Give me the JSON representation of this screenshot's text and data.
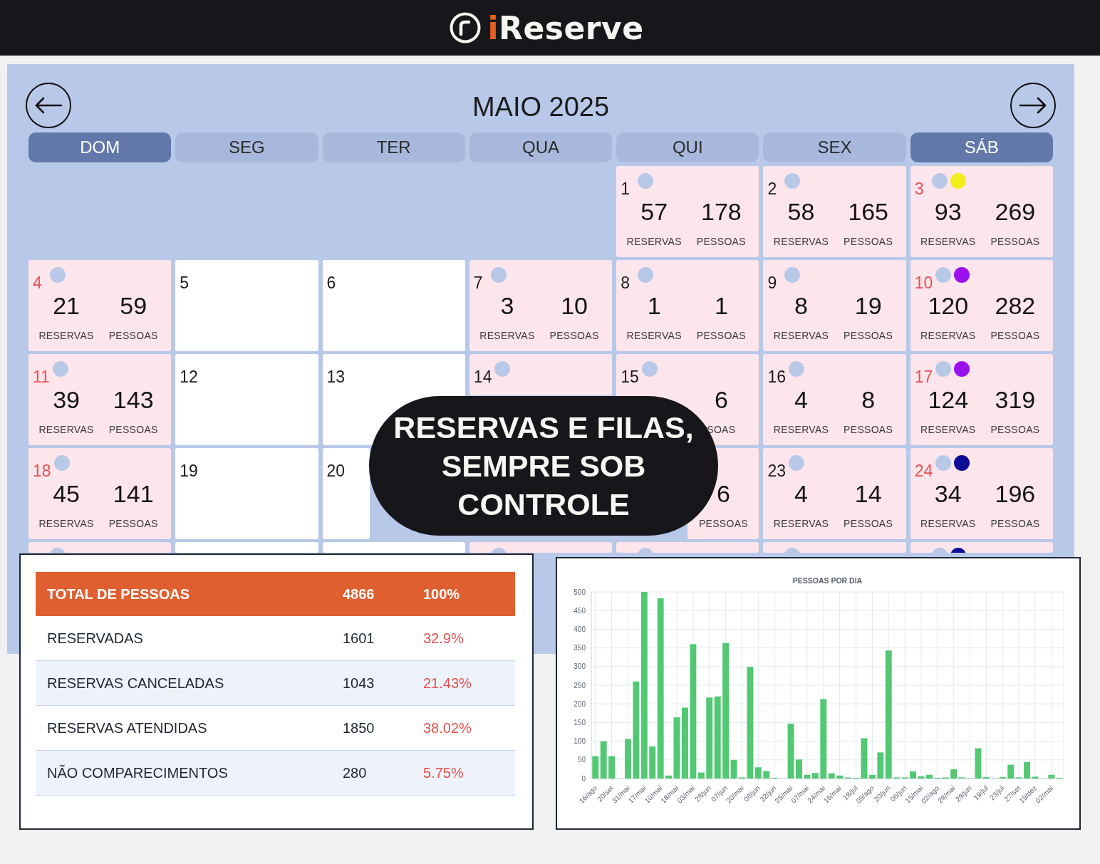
{
  "logo": {
    "text": "iReserve"
  },
  "calendar": {
    "month_title": "MAIO 2025",
    "weekdays": [
      {
        "label": "DOM",
        "selected": true
      },
      {
        "label": "SEG",
        "selected": false
      },
      {
        "label": "TER",
        "selected": false
      },
      {
        "label": "QUA",
        "selected": false
      },
      {
        "label": "QUI",
        "selected": false
      },
      {
        "label": "SEX",
        "selected": false
      },
      {
        "label": "SÁB",
        "selected": true
      }
    ],
    "weeks": [
      {
        "days": [
          {
            "kind": "blank"
          },
          {
            "kind": "blank"
          },
          {
            "kind": "blank"
          },
          {
            "kind": "blank"
          },
          {
            "kind": "open",
            "day": "1",
            "markers": [
              {
                "color": "#b8c9e8"
              }
            ],
            "reservations": {
              "value": "57",
              "label": "RESERVAS"
            },
            "people": {
              "value": "178",
              "label": "PESSOAS"
            }
          },
          {
            "kind": "open",
            "day": "2",
            "markers": [
              {
                "color": "#b8c9e8"
              }
            ],
            "reservations": {
              "value": "58",
              "label": "RESERVAS"
            },
            "people": {
              "value": "165",
              "label": "PESSOAS"
            }
          },
          {
            "kind": "open",
            "day": "3",
            "markers": [
              {
                "color": "#b8c9e8"
              },
              {
                "color": "#f2ee1c"
              }
            ],
            "reservations": {
              "value": "93",
              "label": "RESERVAS"
            },
            "people": {
              "value": "269",
              "label": "PESSOAS"
            }
          }
        ]
      },
      {
        "days": [
          {
            "kind": "open",
            "day": "4",
            "markers": [
              {
                "color": "#b8c9e8"
              }
            ],
            "reservations": {
              "value": "21",
              "label": "RESERVAS"
            },
            "people": {
              "value": "59",
              "label": "PESSOAS"
            }
          },
          {
            "kind": "closed",
            "day": "5"
          },
          {
            "kind": "closed",
            "day": "6"
          },
          {
            "kind": "open",
            "day": "7",
            "markers": [
              {
                "color": "#b8c9e8"
              }
            ],
            "reservations": {
              "value": "3",
              "label": "RESERVAS"
            },
            "people": {
              "value": "10",
              "label": "PESSOAS"
            }
          },
          {
            "kind": "open",
            "day": "8",
            "markers": [
              {
                "color": "#b8c9e8"
              }
            ],
            "reservations": {
              "value": "1",
              "label": "RESERVAS"
            },
            "people": {
              "value": "1",
              "label": "PESSOAS"
            }
          },
          {
            "kind": "open",
            "day": "9",
            "markers": [
              {
                "color": "#b8c9e8"
              }
            ],
            "reservations": {
              "value": "8",
              "label": "RESERVAS"
            },
            "people": {
              "value": "19",
              "label": "PESSOAS"
            }
          },
          {
            "kind": "open",
            "day": "10",
            "markers": [
              {
                "color": "#b8c9e8"
              },
              {
                "color": "#9a10ee"
              }
            ],
            "reservations": {
              "value": "120",
              "label": "RESERVAS"
            },
            "people": {
              "value": "282",
              "label": "PESSOAS"
            }
          }
        ]
      },
      {
        "days": [
          {
            "kind": "open",
            "day": "11",
            "markers": [
              {
                "color": "#b8c9e8"
              }
            ],
            "reservations": {
              "value": "39",
              "label": "RESERVAS"
            },
            "people": {
              "value": "143",
              "label": "PESSOAS"
            }
          },
          {
            "kind": "closed",
            "day": "12"
          },
          {
            "kind": "closed",
            "day": "13"
          },
          {
            "kind": "open",
            "day": "14",
            "markers": [
              {
                "color": "#b8c9e8"
              }
            ]
          },
          {
            "kind": "open",
            "day": "15",
            "markers": [
              {
                "color": "#b8c9e8"
              }
            ],
            "people": {
              "value": "6",
              "label": "SOAS"
            }
          },
          {
            "kind": "open",
            "day": "16",
            "markers": [
              {
                "color": "#b8c9e8"
              }
            ],
            "reservations": {
              "value": "4",
              "label": "RESERVAS"
            },
            "people": {
              "value": "8",
              "label": "PESSOAS"
            }
          },
          {
            "kind": "open",
            "day": "17",
            "markers": [
              {
                "color": "#b8c9e8"
              },
              {
                "color": "#9a10ee"
              }
            ],
            "reservations": {
              "value": "124",
              "label": "RESERVAS"
            },
            "people": {
              "value": "319",
              "label": "PESSOAS"
            }
          }
        ]
      },
      {
        "days": [
          {
            "kind": "open",
            "day": "18",
            "markers": [
              {
                "color": "#b8c9e8"
              }
            ],
            "reservations": {
              "value": "45",
              "label": "RESERVAS"
            },
            "people": {
              "value": "141",
              "label": "PESSOAS"
            }
          },
          {
            "kind": "closed",
            "day": "19"
          },
          {
            "kind": "closed",
            "day": "20"
          },
          {
            "kind": "blank"
          },
          {
            "kind": "open",
            "people": {
              "value": "6",
              "label": "PESSOAS"
            }
          },
          {
            "kind": "open",
            "day": "23",
            "markers": [
              {
                "color": "#b8c9e8"
              }
            ],
            "reservations": {
              "value": "4",
              "label": "RESERVAS"
            },
            "people": {
              "value": "14",
              "label": "PESSOAS"
            }
          },
          {
            "kind": "open",
            "day": "24",
            "markers": [
              {
                "color": "#b8c9e8"
              },
              {
                "color": "#0c0c96"
              }
            ],
            "reservations": {
              "value": "34",
              "label": "RESERVAS"
            },
            "people": {
              "value": "196",
              "label": "PESSOAS"
            }
          }
        ]
      },
      {
        "days": [
          {
            "kind": "open",
            "markers": [
              {
                "color": "#b8c9e8"
              }
            ]
          },
          {
            "kind": "closed"
          },
          {
            "kind": "closed"
          },
          {
            "kind": "open",
            "markers": [
              {
                "color": "#b8c9e8"
              }
            ]
          },
          {
            "kind": "open",
            "markers": [
              {
                "color": "#b8c9e8"
              }
            ]
          },
          {
            "kind": "open",
            "markers": [
              {
                "color": "#b8c9e8"
              }
            ]
          },
          {
            "kind": "open",
            "markers": [
              {
                "color": "#b8c9e8"
              },
              {
                "color": "#0c0c96"
              }
            ]
          }
        ]
      }
    ]
  },
  "headline": {
    "text": "RESERVAS E FILAS,\nSEMPRE SOB\nCONTROLE"
  },
  "summary_table": {
    "header": {
      "label": "TOTAL DE PESSOAS",
      "count": "4866",
      "percent": "100%"
    },
    "rows": [
      {
        "label": "RESERVADAS",
        "count": "1601",
        "percent": "32.9%"
      },
      {
        "label": "RESERVAS CANCELADAS",
        "count": "1043",
        "percent": "21.43%"
      },
      {
        "label": "RESERVAS ATENDIDAS",
        "count": "1850",
        "percent": "38.02%"
      },
      {
        "label": "NÃO COMPARECIMENTOS",
        "count": "280",
        "percent": "5.75%"
      }
    ]
  },
  "chart_panel": {
    "chart_data": {
      "type": "bar",
      "title": "PESSOAS POR DIA",
      "grid": true,
      "categories": [
        "16/ago",
        null,
        "20/set",
        null,
        "31/mai",
        null,
        "17/mai",
        null,
        "10/mai",
        null,
        "18/mai",
        null,
        "03/mai",
        null,
        "28/jun",
        null,
        "07/jun",
        null,
        "20/mai",
        null,
        "08/jun",
        null,
        "22/jun",
        null,
        "25/mai",
        null,
        "07/mai",
        null,
        "24/mai",
        null,
        "16/mai",
        null,
        "18/jul",
        null,
        "09/ago",
        null,
        "20/jun",
        null,
        "06/jun",
        null,
        "15/mai",
        null,
        "02/ago",
        null,
        "28/mai",
        null,
        "29/jun",
        null,
        "19/jul",
        null,
        "23/jul",
        null,
        "27/set",
        null,
        "19/dez",
        null,
        "02/mai",
        null
      ],
      "series": [
        {
          "color": "#52c873",
          "values": [
            60,
            100,
            60,
            0,
            106,
            260,
            500,
            86,
            483,
            8,
            164,
            190,
            360,
            16,
            217,
            220,
            363,
            50,
            3,
            299,
            30,
            20,
            2,
            0,
            147,
            51,
            10,
            15,
            213,
            14,
            8,
            3,
            2,
            108,
            10,
            70,
            343,
            3,
            3,
            19,
            6,
            10,
            2,
            3,
            25,
            3,
            1,
            81,
            4,
            0,
            4,
            37,
            3,
            44,
            5,
            0,
            10,
            2
          ]
        }
      ],
      "ylim": [
        0,
        500
      ],
      "yticks": [
        0,
        50,
        100,
        150,
        200,
        250,
        300,
        350,
        400,
        450,
        500
      ]
    }
  }
}
